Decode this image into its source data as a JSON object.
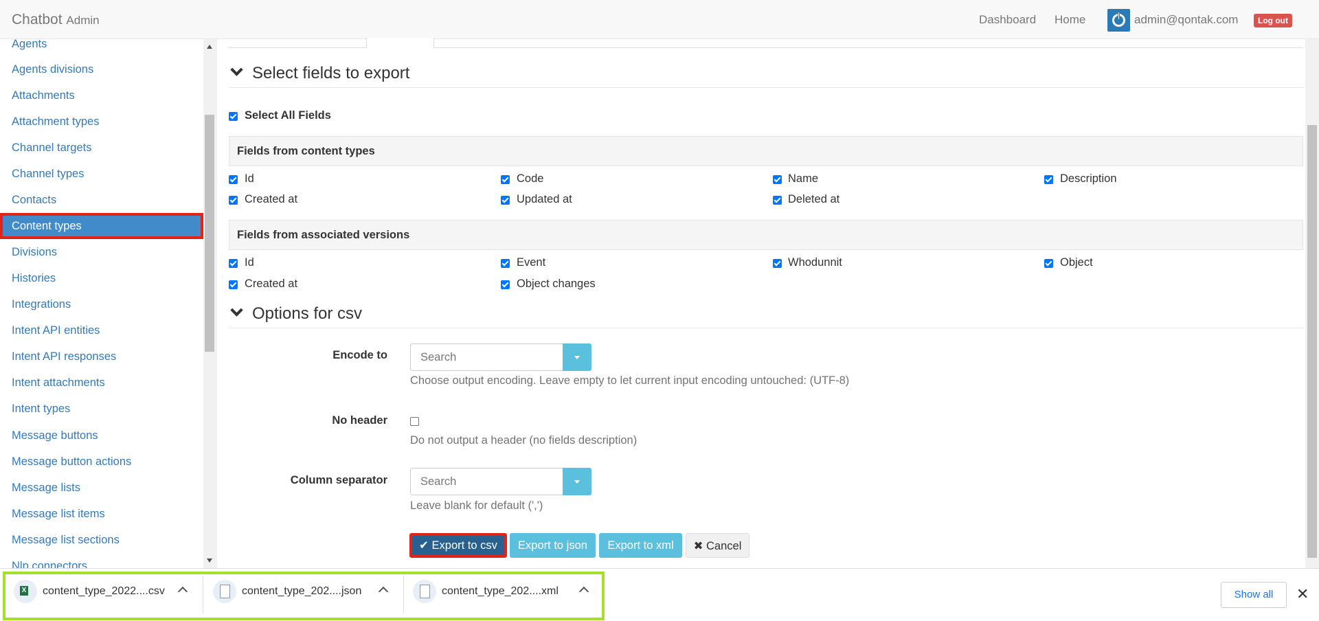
{
  "navbar": {
    "brand": "Chatbot",
    "brand_sub": "Admin",
    "links": [
      "Dashboard",
      "Home"
    ],
    "user": "admin@qontak.com",
    "logout": "Log out"
  },
  "sidebar": {
    "items": [
      {
        "label": "Agents"
      },
      {
        "label": "Agents divisions"
      },
      {
        "label": "Attachments"
      },
      {
        "label": "Attachment types"
      },
      {
        "label": "Channel targets"
      },
      {
        "label": "Channel types"
      },
      {
        "label": "Contacts"
      },
      {
        "label": "Content types",
        "active": true
      },
      {
        "label": "Divisions"
      },
      {
        "label": "Histories"
      },
      {
        "label": "Integrations"
      },
      {
        "label": "Intent API entities"
      },
      {
        "label": "Intent API responses"
      },
      {
        "label": "Intent attachments"
      },
      {
        "label": "Intent types"
      },
      {
        "label": "Message buttons"
      },
      {
        "label": "Message button actions"
      },
      {
        "label": "Message lists"
      },
      {
        "label": "Message list items"
      },
      {
        "label": "Message list sections"
      },
      {
        "label": "Nlp connectors"
      }
    ]
  },
  "export": {
    "section_fields": "Select fields to export",
    "select_all": "Select All Fields",
    "content_types_header": "Fields from content types",
    "content_type_fields": [
      "Id",
      "Code",
      "Name",
      "Description",
      "Created at",
      "Updated at",
      "Deleted at"
    ],
    "versions_header": "Fields from associated versions",
    "version_fields": [
      "Id",
      "Event",
      "Whodunnit",
      "Object",
      "Created at",
      "Object changes"
    ],
    "section_options": "Options for csv",
    "encode_label": "Encode to",
    "encode_placeholder": "Search",
    "encode_help": "Choose output encoding. Leave empty to let current input encoding untouched: (UTF-8)",
    "no_header_label": "No header",
    "no_header_help": "Do not output a header (no fields description)",
    "separator_label": "Column separator",
    "separator_placeholder": "Search",
    "separator_help": "Leave blank for default (',')",
    "btn_csv": "Export to csv",
    "btn_json": "Export to json",
    "btn_xml": "Export to xml",
    "btn_cancel": "Cancel"
  },
  "downloads": {
    "items": [
      {
        "name": "content_type_2022....csv",
        "icon": "excel-file-icon"
      },
      {
        "name": "content_type_202....json",
        "icon": "file-icon"
      },
      {
        "name": "content_type_202....xml",
        "icon": "file-icon"
      }
    ],
    "show_all": "Show all"
  },
  "colors": {
    "active_nav": "#428bca",
    "highlight_red": "#e2231a",
    "highlight_green": "#a5e028",
    "primary_button": "#286090",
    "info_button": "#5bc0de"
  }
}
